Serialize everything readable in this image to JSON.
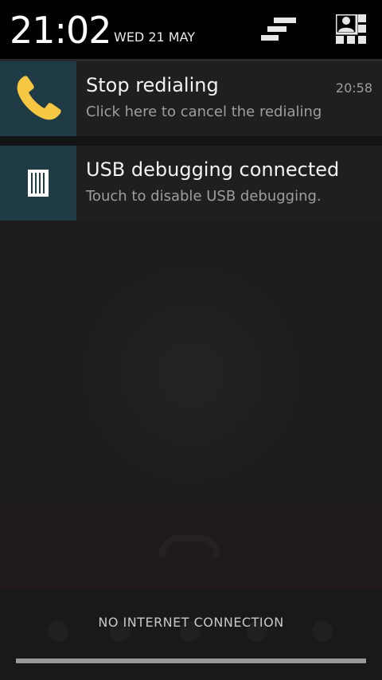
{
  "header": {
    "time": "21:02",
    "date": "WED 21 MAY",
    "icons": [
      "notification-list-icon",
      "quick-settings-icon"
    ]
  },
  "notifications": [
    {
      "icon": "phone-icon",
      "title": "Stop redialing",
      "text": "Click here to cancel the redialing",
      "time": "20:58",
      "accent": "#f5c743"
    },
    {
      "icon": "usb-icon",
      "title": "USB debugging connected",
      "text": "Touch to disable USB debugging."
    }
  ],
  "footer": {
    "carrier": "NO INTERNET CONNECTION"
  },
  "colors": {
    "icon_bg": "#1e3b46",
    "phone": "#f5c743",
    "header_bg": "#000000"
  }
}
